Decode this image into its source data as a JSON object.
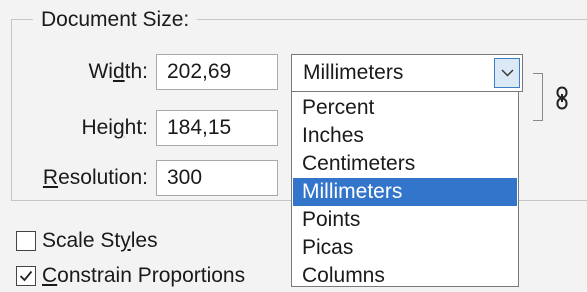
{
  "section": {
    "title": "Document Size:"
  },
  "fields": {
    "width": {
      "label_pre": "Wi",
      "label_u": "d",
      "label_post": "th:",
      "value": "202,69"
    },
    "height": {
      "label_pre": "Hei",
      "label_u": "g",
      "label_post": "ht:",
      "value": "184,15"
    },
    "resolution": {
      "label_pre": "",
      "label_u": "R",
      "label_post": "esolution:",
      "value": "300"
    }
  },
  "unit_select": {
    "selected": "Millimeters",
    "options": [
      "Percent",
      "Inches",
      "Centimeters",
      "Millimeters",
      "Points",
      "Picas",
      "Columns"
    ],
    "highlighted_index": 3
  },
  "checkboxes": {
    "scale_styles": {
      "label_pre": "Scale St",
      "label_u": "y",
      "label_post": "les",
      "checked": false
    },
    "constrain": {
      "label_pre": "",
      "label_u": "C",
      "label_post": "onstrain Proportions",
      "checked": true
    }
  },
  "icons": {
    "link": "chain-link-icon",
    "dropdown": "chevron-down-icon",
    "check": "check-icon"
  },
  "colors": {
    "highlight": "#3375cb",
    "button_border": "#3b80c4",
    "background": "#f3f3f3"
  }
}
